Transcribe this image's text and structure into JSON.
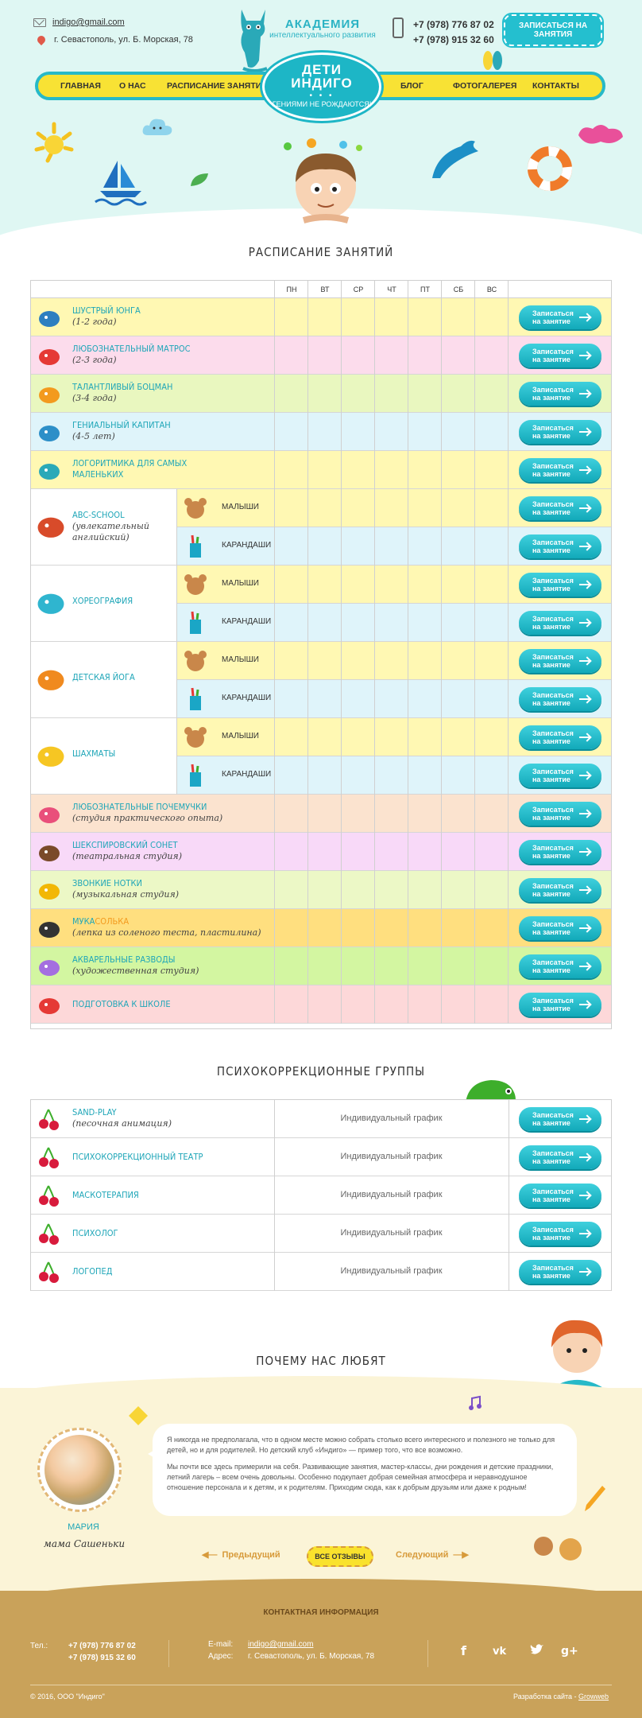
{
  "header": {
    "email": "indigo@gmail.com",
    "address": "г. Севастополь, ул. Б. Морская, 78",
    "academy_title": "АКАДЕМИЯ",
    "academy_subtitle": "интеллектуального развития",
    "phone1": "+7 (978) 776 87 02",
    "phone2": "+7 (978) 915 32 60",
    "signup_label": "Записаться на занятия",
    "logo_line1": "ДЕТИ",
    "logo_line2": "ИНДИГО",
    "logo_dots": "• • •",
    "logo_slogan": "Гениями не рождаются!",
    "nav": [
      "ГЛАВНАЯ",
      "О НАС",
      "РАСПИСАНИЕ ЗАНЯТИЙ",
      "БЛОГ",
      "ФОТОГАЛЕРЕЯ",
      "КОНТАКТЫ"
    ]
  },
  "schedule": {
    "title": "РАСПИСАНИЕ ЗАНЯТИЙ",
    "days": [
      "ПН",
      "ВТ",
      "СР",
      "ЧТ",
      "ПТ",
      "СБ",
      "ВС"
    ],
    "button_line1": "Записаться",
    "button_line2": "на занятие",
    "simple_rows": [
      {
        "name": "ШУСТРЫЙ ЮНГА",
        "sub": "(1-2 года)",
        "icon": "whale-icon"
      },
      {
        "name": "ЛЮБОЗНАТЕЛЬНЫЙ МАТРОС",
        "sub": "(2-3 года)",
        "icon": "crab-icon"
      },
      {
        "name": "ТАЛАНТЛИВЫЙ БОЦМАН",
        "sub": "(3-4 года)",
        "icon": "seahorse-icon"
      },
      {
        "name": "ГЕНИАЛЬНЫЙ КАПИТАН",
        "sub": "(4-5 лет)",
        "icon": "shark-icon"
      },
      {
        "name": "ЛОГОРИТМИКА ДЛЯ САМЫХ",
        "sub": "МАЛЕНЬКИХ",
        "icon": "flip-flops-icon"
      }
    ],
    "groups": [
      {
        "name": "ABC-SCHOOL",
        "sub": "(увлекательный английский)",
        "icon": "books-icon"
      },
      {
        "name": "ХОРЕОГРАФИЯ",
        "sub": "",
        "icon": "bunny-icon"
      },
      {
        "name": "ДЕТСКАЯ ЙОГА",
        "sub": "",
        "icon": "giraffe-icon"
      },
      {
        "name": "ШАХМАТЫ",
        "sub": "",
        "icon": "chess-knight-icon"
      }
    ],
    "subgroups": [
      "МАЛЫШИ",
      "КАРАНДАШИ"
    ],
    "extra_rows": [
      {
        "name": "ЛЮБОЗНАТЕЛЬНЫЕ ПОЧЕМУЧКИ",
        "sub": "(студия практического опыта)",
        "icon": "snail-icon"
      },
      {
        "name": "ШЕКСПИРОВСКИЙ СОНЕТ",
        "sub": "(театральная студия)",
        "icon": "pirate-icon"
      },
      {
        "name": "ЗВОНКИЕ НОТКИ",
        "sub": "(музыкальная студия)",
        "icon": "music-notes-icon"
      },
      {
        "name_part1": "МУКА",
        "name_part2": "СОЛЬКА",
        "sub": "(лепка из соленого теста, пластилина)",
        "icon": "panda-icon"
      },
      {
        "name": "АКВАРЕЛЬНЫЕ РАЗВОДЫ",
        "sub": "(художественная студия)",
        "icon": "butterfly-icon"
      },
      {
        "name": "ПОДГОТОВКА К ШКОЛЕ",
        "sub": "",
        "icon": "strawberry-icon"
      }
    ]
  },
  "psycho": {
    "title": "ПСИХОКОРРЕКЦИОННЫЕ ГРУППЫ",
    "schedule_text": "Индивидуальный график",
    "rows": [
      {
        "name": "SAND-PLAY",
        "sub": "(песочная анимация)"
      },
      {
        "name": "ПСИХОКОРРЕКЦИОННЫЙ ТЕАТР",
        "sub": ""
      },
      {
        "name": "МАСКОТЕРАПИЯ",
        "sub": ""
      },
      {
        "name": "ПСИХОЛОГ",
        "sub": ""
      },
      {
        "name": "ЛОГОПЕД",
        "sub": ""
      }
    ]
  },
  "reviews": {
    "title": "ПОЧЕМУ НАС ЛЮБЯТ",
    "name": "МАРИЯ",
    "role": "мама Сашеньки",
    "text1": "Я никогда не предполагала, что в одном месте можно собрать столько всего интересного и полезного не только для детей, но и для родителей. Но детский клуб «Индиго» — пример того, что все возможно.",
    "text2": "Мы почти все здесь примерили на себя. Развивающие занятия, мастер-классы, дни рождения и детские праздники, летний лагерь – всем очень довольны. Особенно подкупает добрая семейная атмосфера и неравнодушное отношение персонала и к детям, и к родителям. Приходим сюда, как к добрым друзьям или даже к родным!",
    "prev": "Предыдущий",
    "all": "Все отзывы",
    "next": "Следующий"
  },
  "footer": {
    "title": "КОНТАКТНАЯ ИНФОРМАЦИЯ",
    "tel_label": "Тел.:",
    "phone1": "+7 (978) 776 87 02",
    "phone2": "+7 (978) 915 32 60",
    "email_label": "E-mail:",
    "email": "indigo@gmail.com",
    "address_label": "Адрес:",
    "address": "г. Севастополь, ул. Б. Морская, 78",
    "copyright": "© 2016, ООО \"Индиго\"",
    "dev_label": "Разработка сайта -",
    "dev_name": "Growweb",
    "social": [
      "f",
      "vk",
      "twitter",
      "g+"
    ]
  },
  "colors": {
    "accent": "#1db6c6",
    "nav_yellow": "#f8e234",
    "header_bg": "#dff7f3",
    "footer_bg": "#c9a25a"
  }
}
